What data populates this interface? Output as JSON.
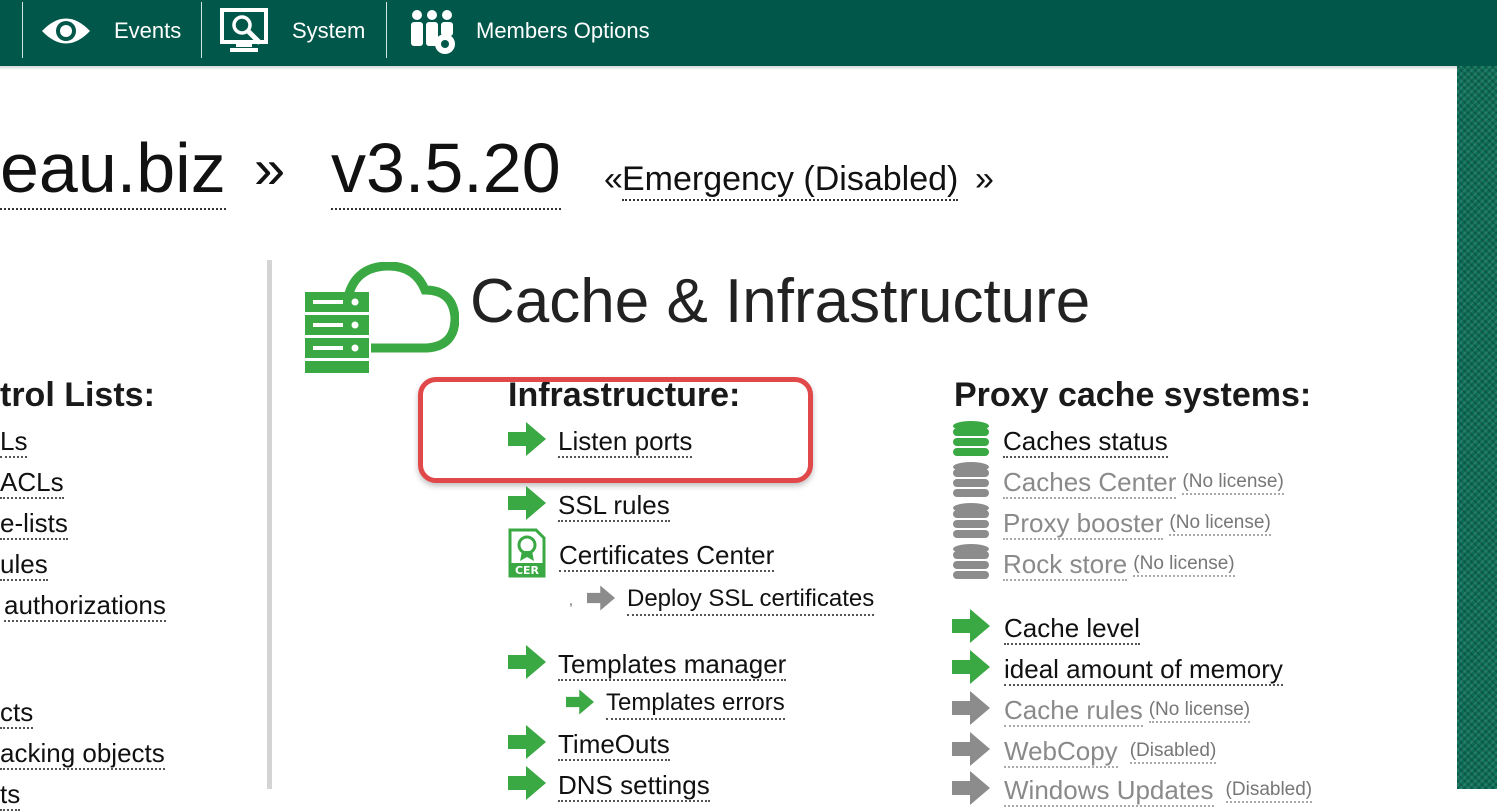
{
  "nav": {
    "events": "Events",
    "system": "System",
    "members": "Members Options"
  },
  "headline": {
    "site": "eau.biz",
    "sep": "»",
    "version": "v3.5.20",
    "mode_open": "«",
    "mode": "Emergency (Disabled)",
    "mode_close": "»"
  },
  "left_column": {
    "title": "trol Lists:",
    "items": [
      "Ls",
      "ACLs",
      "e-lists",
      "ules",
      "authorizations",
      "cts",
      "acking objects",
      "ts"
    ]
  },
  "page_title": "Cache & Infrastructure",
  "infrastructure": {
    "title": "Infrastructure:",
    "listen_ports": "Listen ports",
    "ssl_rules": "SSL rules",
    "certificates_center": "Certificates Center",
    "bullet": ",",
    "deploy_ssl": "Deploy SSL certificates",
    "templates_manager": "Templates manager",
    "templates_errors": "Templates errors",
    "timeouts": "TimeOuts",
    "dns_settings": "DNS settings"
  },
  "proxy": {
    "title": "Proxy cache systems:",
    "caches_status": "Caches status",
    "caches_center": "Caches Center",
    "proxy_booster": "Proxy booster",
    "rock_store": "Rock store",
    "no_license": "(No license)",
    "cache_level": "Cache level",
    "ideal_memory": "ideal amount of memory",
    "cache_rules": "Cache rules",
    "webcopy": "WebCopy",
    "disabled": "(Disabled)",
    "windows_updates": "Windows Updates",
    "disabled_partial": "(Disabled)"
  },
  "colors": {
    "topbar": "#00574a",
    "green_icon": "#3aa843",
    "grey_icon": "#8c8c8c",
    "highlight": "#e0484a"
  }
}
